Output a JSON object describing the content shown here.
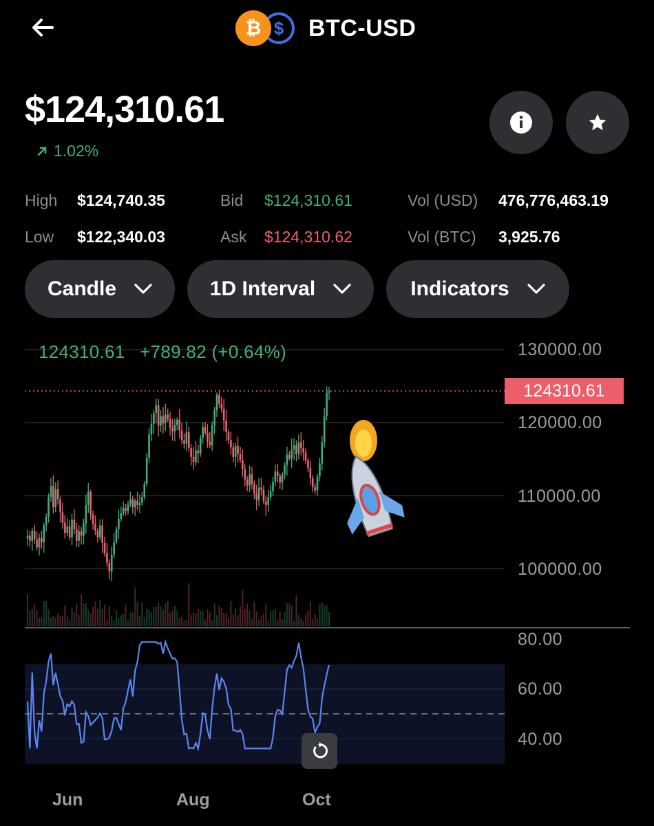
{
  "header": {
    "title": "BTC-USD",
    "btc_glyph": "₿",
    "usd_glyph": "$"
  },
  "price": {
    "value": "$124,310.61",
    "change": "1.02%",
    "change_color": "#3fb17d"
  },
  "stats": {
    "high_label": "High",
    "high_value": "$124,740.35",
    "low_label": "Low",
    "low_value": "$122,340.03",
    "bid_label": "Bid",
    "bid_value": "$124,310.61",
    "ask_label": "Ask",
    "ask_value": "$124,310.62",
    "vol_usd_label": "Vol (USD)",
    "vol_usd_value": "476,776,463.19",
    "vol_btc_label": "Vol (BTC)",
    "vol_btc_value": "3,925.76"
  },
  "controls": {
    "candle": "Candle",
    "interval": "1D Interval",
    "indicators": "Indicators"
  },
  "chart": {
    "header_price": "124310.61",
    "header_change": "+789.82 (+0.64%)",
    "current_price_tag": "124310.61",
    "price_ticks": [
      "130000.00",
      "120000.00",
      "110000.00",
      "100000.00"
    ],
    "rsi_ticks": [
      "80.00",
      "60.00",
      "40.00"
    ],
    "months": [
      "Jun",
      "Aug",
      "Oct"
    ]
  },
  "colors": {
    "up": "#3fb17d",
    "down": "#f0616d",
    "rsi_line": "#5b86f0",
    "accent_btc": "#f7931a",
    "accent_usd": "#3b6fe6"
  },
  "chart_data": {
    "type": "candlestick",
    "price_ylim": [
      97000,
      130500
    ],
    "current_price": 124310.61,
    "close_series": [
      104500,
      103800,
      105200,
      104000,
      102900,
      104200,
      103600,
      105900,
      107100,
      109800,
      111300,
      108400,
      110900,
      109500,
      107700,
      106300,
      104900,
      105800,
      104300,
      106700,
      105400,
      103800,
      105100,
      104500,
      106200,
      108700,
      110500,
      107400,
      106100,
      105200,
      104300,
      105900,
      103500,
      102100,
      100800,
      99600,
      101900,
      103600,
      105400,
      106800,
      107600,
      108300,
      107900,
      108800,
      109500,
      108400,
      109300,
      108700,
      109000,
      109800,
      111600,
      115200,
      118400,
      119800,
      121300,
      122400,
      119600,
      120900,
      119900,
      121100,
      120500,
      119300,
      118800,
      119700,
      120400,
      118900,
      117600,
      117100,
      118700,
      116500,
      115300,
      114600,
      116200,
      115800,
      117900,
      119400,
      118600,
      117400,
      116900,
      119600,
      121700,
      123800,
      122600,
      121900,
      120300,
      118700,
      117600,
      116600,
      115300,
      116800,
      115700,
      114900,
      113600,
      112200,
      111400,
      112900,
      111600,
      110300,
      109400,
      111100,
      110800,
      109200,
      108700,
      109800,
      110600,
      111900,
      113300,
      112700,
      111800,
      112900,
      114200,
      115600,
      115100,
      116300,
      116900,
      115700,
      117300,
      116500,
      115900,
      114800,
      113800,
      112400,
      111200,
      110700,
      112600,
      114400,
      117300,
      120900,
      124100,
      124310
    ]
  }
}
